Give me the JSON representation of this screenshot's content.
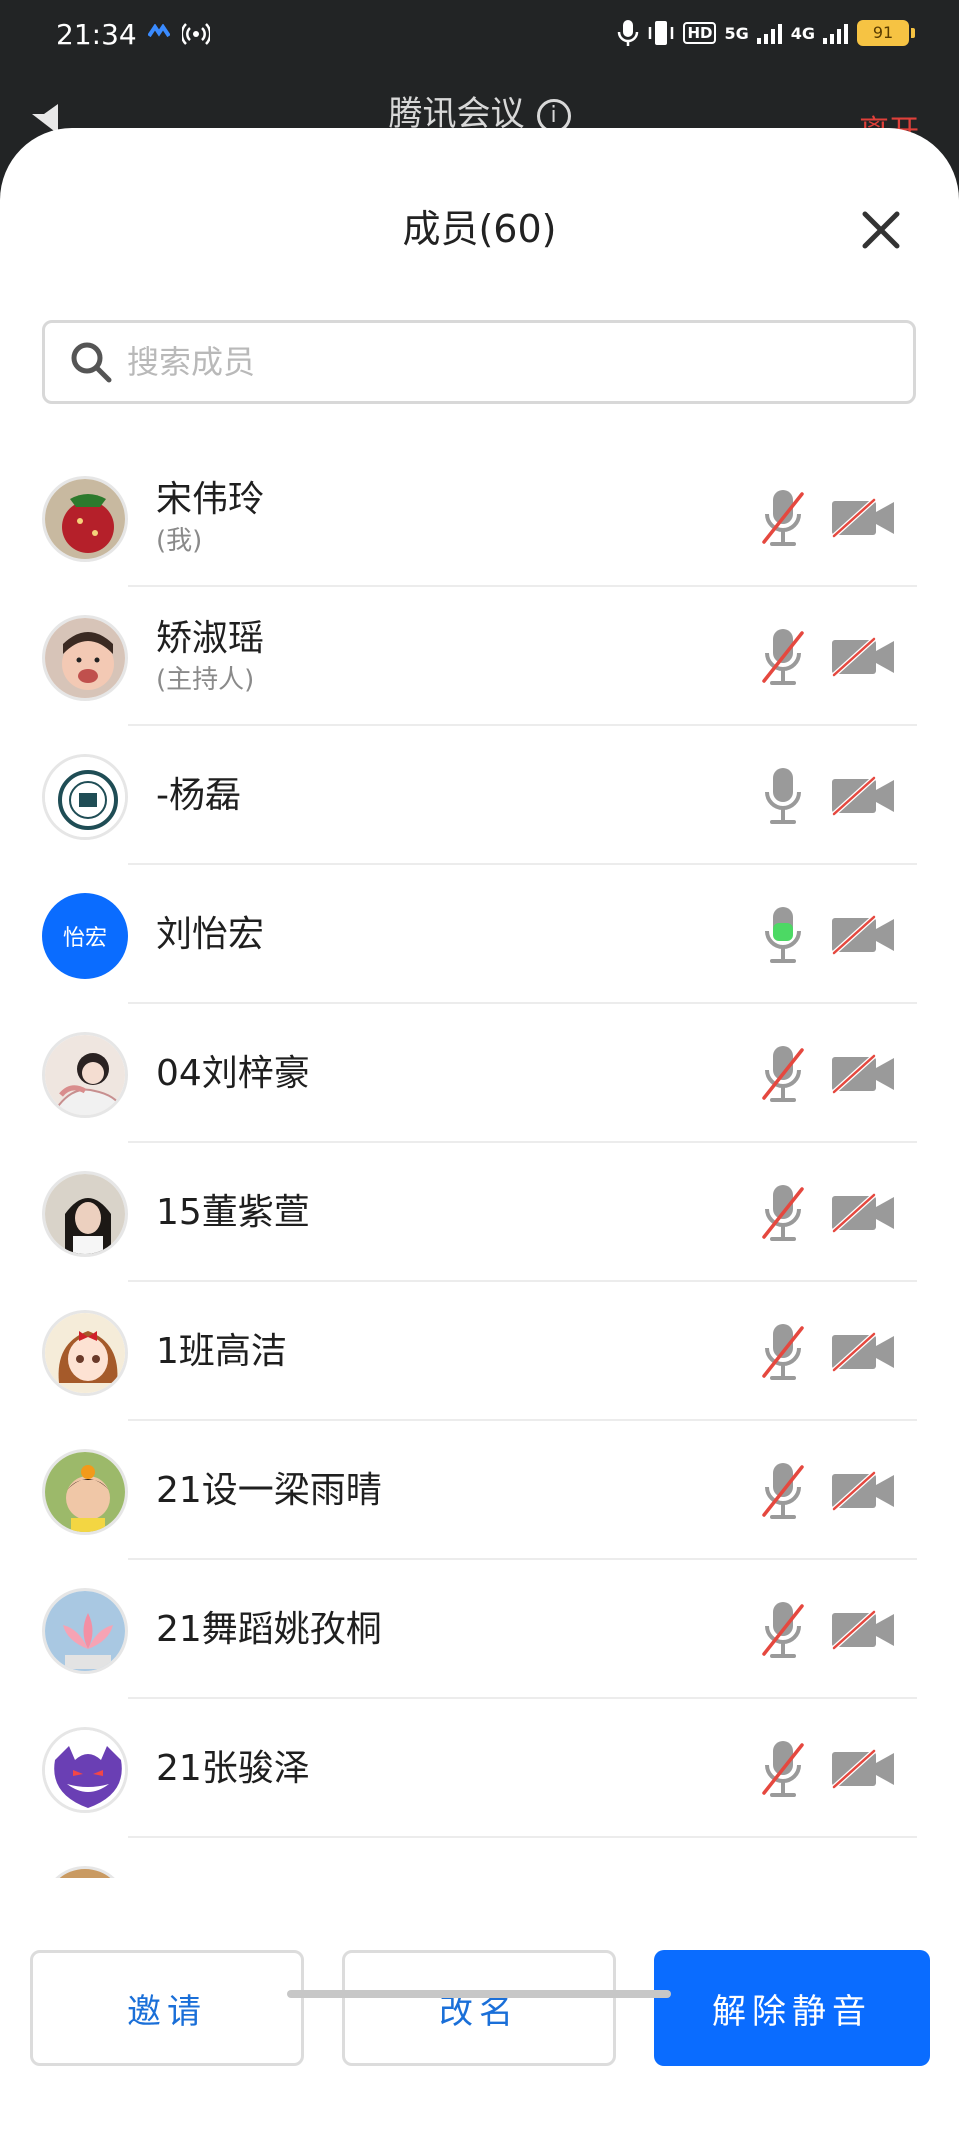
{
  "status_bar": {
    "time": "21:34",
    "network_5g": "5G",
    "network_4g": "4G",
    "hd": "HD",
    "battery": "91"
  },
  "app": {
    "title": "腾讯会议",
    "right_action": "离开"
  },
  "panel": {
    "title": "成员(60)",
    "search_placeholder": "搜索成员",
    "members": [
      {
        "name": "宋伟玲",
        "role": "(我)",
        "avatar": "photo-strawberry",
        "mic": "muted",
        "camera": "off"
      },
      {
        "name": "矫淑瑶",
        "role": "(主持人)",
        "avatar": "photo-child",
        "mic": "muted",
        "camera": "off"
      },
      {
        "name": "-杨磊",
        "role": "",
        "avatar": "logo-seal",
        "mic": "on",
        "camera": "off"
      },
      {
        "name": "刘怡宏",
        "role": "",
        "avatar_text": "怡宏",
        "mic": "speaking",
        "camera": "off"
      },
      {
        "name": "04刘梓豪",
        "role": "",
        "avatar": "photo-illustration",
        "mic": "muted",
        "camera": "off"
      },
      {
        "name": "15董紫萱",
        "role": "",
        "avatar": "photo-girl",
        "mic": "muted",
        "camera": "off"
      },
      {
        "name": "1班高洁",
        "role": "",
        "avatar": "cartoon-girl",
        "mic": "muted",
        "camera": "off"
      },
      {
        "name": "21设一梁雨晴",
        "role": "",
        "avatar": "photo-toddler",
        "mic": "muted",
        "camera": "off"
      },
      {
        "name": "21舞蹈姚孜桐",
        "role": "",
        "avatar": "photo-lotus",
        "mic": "muted",
        "camera": "off"
      },
      {
        "name": "21张骏泽",
        "role": "",
        "avatar": "cartoon-purple",
        "mic": "muted",
        "camera": "off"
      }
    ]
  },
  "actions": {
    "invite": "邀请",
    "rename": "改名",
    "unmute_all": "解除静音"
  },
  "colors": {
    "accent": "#0A6CFF",
    "muted_red": "#E5483F",
    "speaking_green": "#4CD964"
  }
}
